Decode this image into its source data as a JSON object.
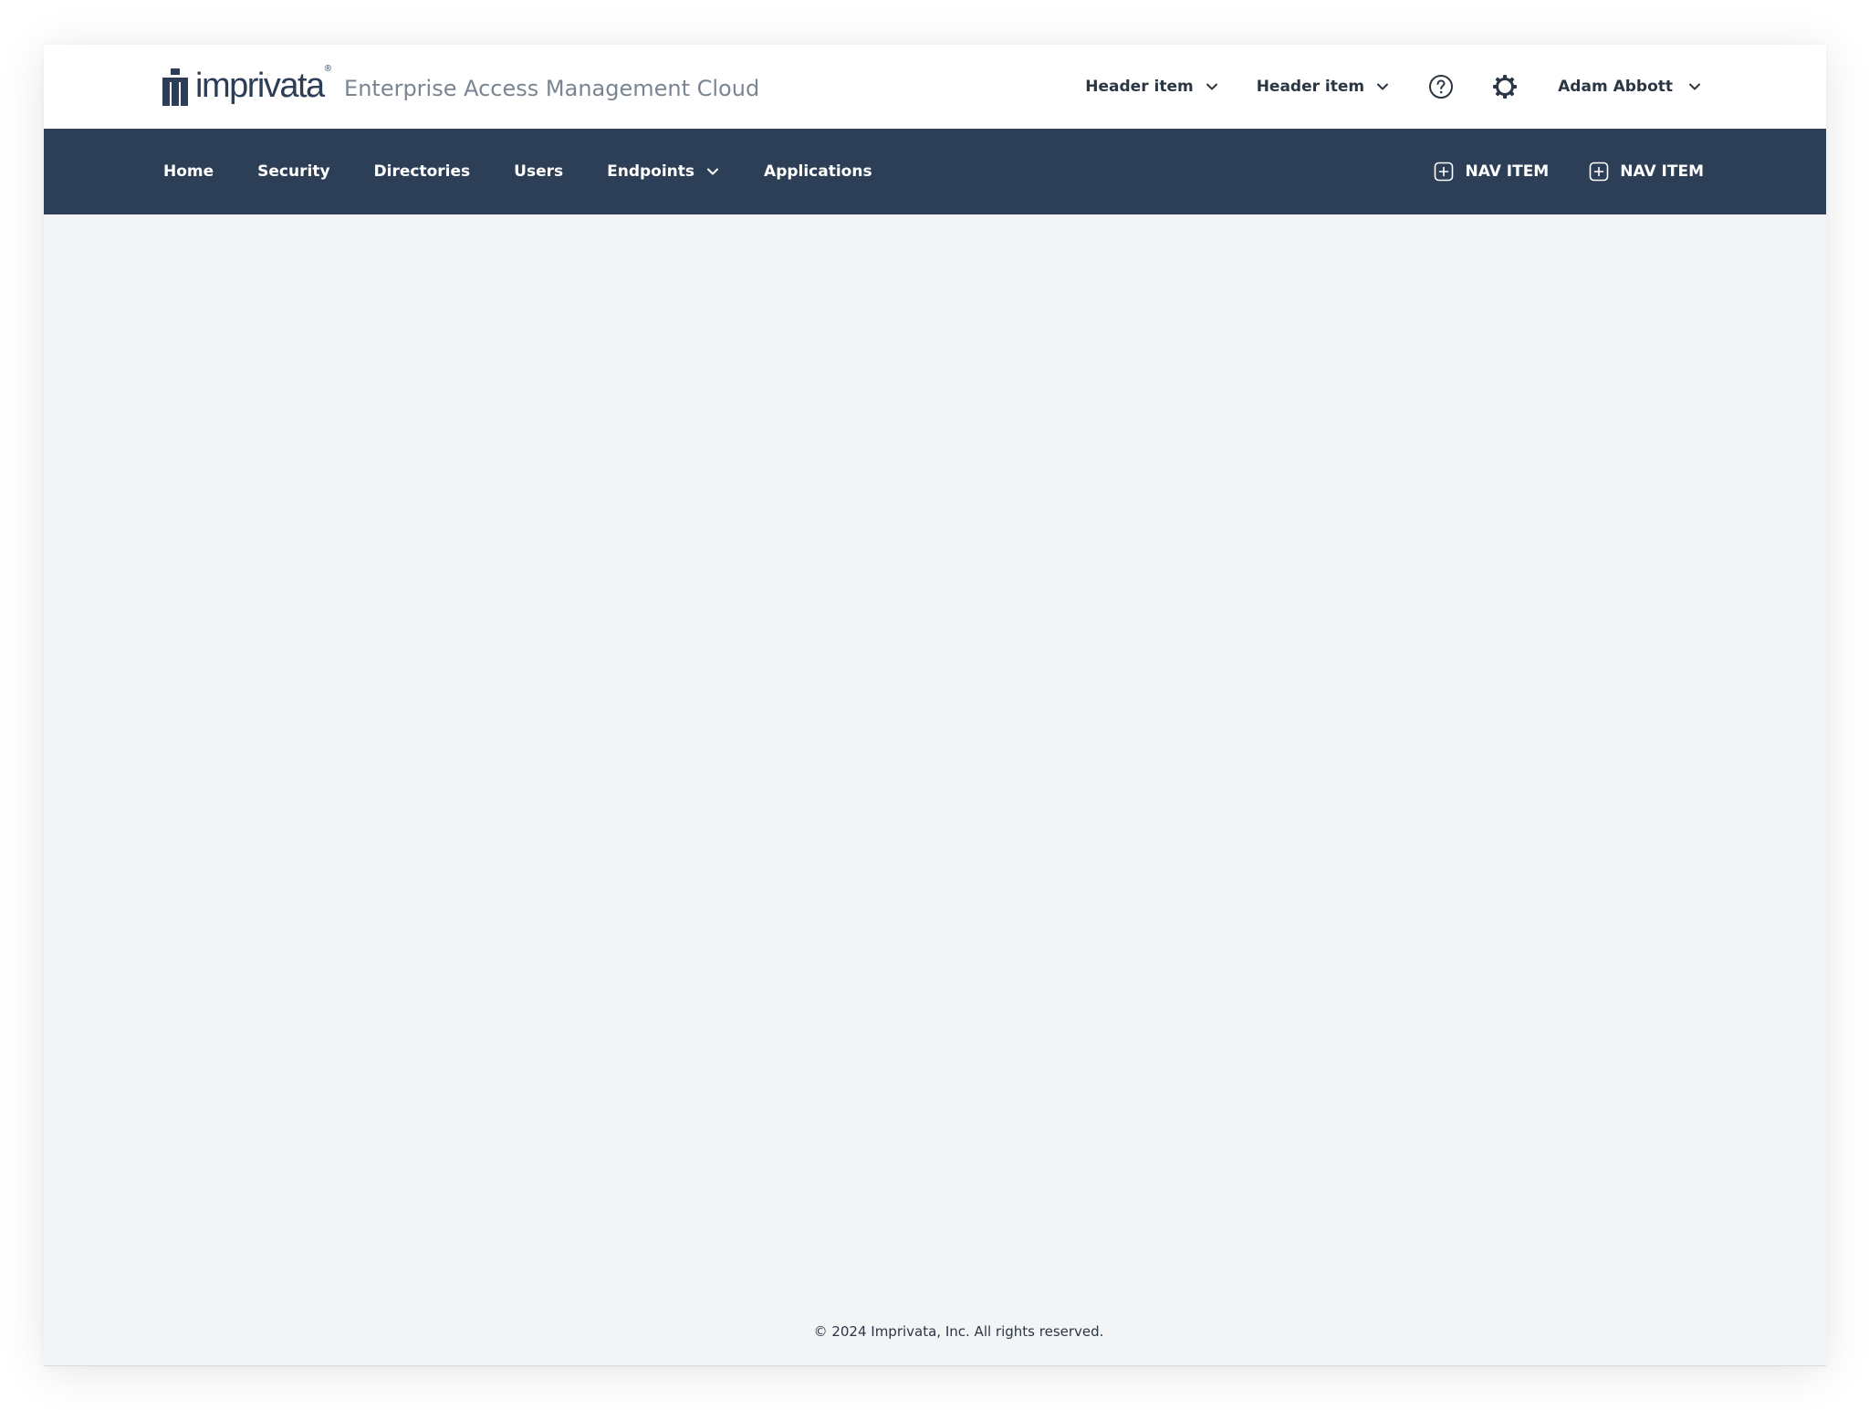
{
  "header": {
    "brand_word": "imprivata",
    "brand_mark": "®",
    "product_name": "Enterprise Access Management Cloud",
    "items": [
      {
        "label": "Header item",
        "icon": "chevron-down-icon"
      },
      {
        "label": "Header item",
        "icon": "chevron-down-icon"
      }
    ],
    "help_icon": "help-circle-icon",
    "settings_icon": "gear-icon",
    "user": {
      "name": "Adam Abbott",
      "icon": "chevron-down-icon"
    }
  },
  "nav": {
    "items": [
      {
        "label": "Home"
      },
      {
        "label": "Security"
      },
      {
        "label": "Directories"
      },
      {
        "label": "Users"
      },
      {
        "label": "Endpoints",
        "has_dropdown": true
      },
      {
        "label": "Applications"
      }
    ],
    "actions": [
      {
        "label": "NAV ITEM",
        "icon": "plus-square-icon"
      },
      {
        "label": "NAV ITEM",
        "icon": "plus-square-icon"
      }
    ]
  },
  "footer": {
    "copyright": "© 2024 Imprivata, Inc. All rights reserved."
  },
  "colors": {
    "nav_bg": "#2d3f57",
    "brand": "#2c3e57",
    "page_bg": "#f3f4f6",
    "product_text": "#7a8593"
  }
}
